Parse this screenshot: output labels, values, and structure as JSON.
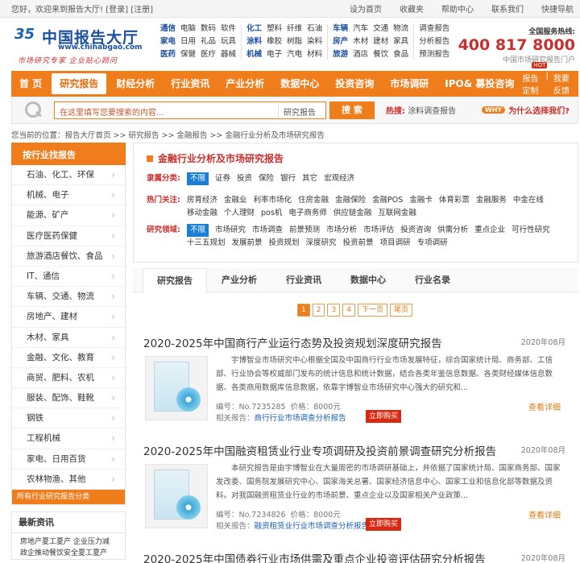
{
  "topbar": {
    "welcome": "您好，欢迎来到报告大厅!",
    "login": "[登录]",
    "register": "[注册]",
    "links": [
      "设为首页",
      "收藏夹",
      "帮助中心",
      "联系我们",
      "快捷导航"
    ]
  },
  "logo": {
    "name": "中国报告大厅",
    "url": "www.chinabgao.com",
    "slogan": "市场研究专家  企业贴心顾问"
  },
  "categories": [
    {
      "bold": "通信",
      "items": [
        "电脑",
        "数码",
        "软件"
      ]
    },
    {
      "bold": "家电",
      "items": [
        "日用",
        "礼品",
        "玩具"
      ]
    },
    {
      "bold": "医药",
      "items": [
        "保健",
        "医疗",
        "器械"
      ]
    },
    {
      "bold": "化工",
      "items": [
        "塑料",
        "纤维",
        "石油"
      ]
    },
    {
      "bold": "涂料",
      "items": [
        "橡胶",
        "树脂",
        "染料"
      ]
    },
    {
      "bold": "机械",
      "items": [
        "电子",
        "汽电",
        "材料"
      ]
    },
    {
      "bold": "车辆",
      "items": [
        "汽车",
        "交通",
        "物流"
      ]
    },
    {
      "bold": "房产",
      "items": [
        "木材",
        "建材",
        "家具"
      ]
    },
    {
      "bold": "旅游",
      "items": [
        "酒店",
        "餐饮",
        "食品"
      ]
    }
  ],
  "categories_extra": [
    "调查报告",
    "分析报告",
    "预测报告"
  ],
  "hotline": {
    "title": "全国服务热线:",
    "number": "400 817 8000",
    "sub": "中国市场研究报告门户"
  },
  "nav": {
    "items": [
      "首 页",
      "研究报告",
      "财经分析",
      "行业资讯",
      "产业分析",
      "数据中心",
      "投资咨询",
      "市场调研",
      "IPO& 募投咨询"
    ],
    "active_index": 1,
    "hot": "HOT",
    "right": [
      "报告定制",
      "我要反馈"
    ]
  },
  "search": {
    "placeholder": "在这里填写您要搜索的内容...",
    "select": "研究报告",
    "button": "搜 索",
    "hot_label": "热搜:",
    "hot_term": "涂料调查报告",
    "why_badge": "WHY",
    "why_text": "为什么选择我们?"
  },
  "breadcrumb": "您当前的位置：报告大厅首页 >> 研究报告 >> 金融报告 >> 金融行业分析及市场研究报告",
  "sidebar": {
    "title": "按行业找报告",
    "items": [
      "石油、化工、环保",
      "机械、电子",
      "能源、矿产",
      "医疗医药保健",
      "旅游酒店餐饮、食品",
      "IT、通信",
      "车辆、交通、物流",
      "房地产、建材",
      "木材、家具",
      "金融、文化、教育",
      "商贸、肥料、农机",
      "服装、配饰、鞋靴",
      "钢铁",
      "工程机械",
      "家电、日用百货",
      "农林物渔、其他"
    ],
    "footer": "所有行业研究报告分类",
    "news_title": "最新资讯",
    "news": [
      "房地产夏工夏产 企业压力减",
      "政企推动餐饮安全夏工夏产"
    ]
  },
  "filter": {
    "title": "金融行业分析及市场研究报告",
    "rows": [
      {
        "label": "隶属分类:",
        "selected": "不限",
        "items": [
          "证券",
          "投资",
          "保险",
          "银行",
          "其它",
          "宏观经济"
        ]
      },
      {
        "label": "热门关注:",
        "selected": "",
        "items": [
          "房育经济",
          "金融业",
          "利率市场化",
          "住房金融",
          "金融保险",
          "金融POS",
          "金融卡",
          "体育彩票",
          "金融服务",
          "中金在线",
          "移动金融",
          "个人理财",
          "pos机",
          "电子商务师",
          "供应链金融",
          "互联网金融"
        ]
      },
      {
        "label": "研究领域:",
        "selected": "不限",
        "items": [
          "市场研究",
          "市场调查",
          "前景预测",
          "市场分析",
          "市场评估",
          "投资咨询",
          "供需分析",
          "重点企业",
          "可行性研究",
          "十三五规划",
          "发展前景",
          "投资规划",
          "深度研究",
          "投资前景",
          "项目调研",
          "专项调研"
        ]
      }
    ]
  },
  "tabs": [
    "研究报告",
    "产业分析",
    "行业资讯",
    "数据中心",
    "行业名录"
  ],
  "pager": [
    "1",
    "2",
    "3",
    "4",
    "下一页",
    "尾页"
  ],
  "reports": [
    {
      "title": "2020-2025年中国商行产业运行态势及投资规划深度研究报告",
      "date": "2020年08月",
      "desc": "宇博智业市场研究中心根据全国及中国商行行业市场发展特征，综合国家统计局、商务部、工信部、行业协会等权威部门发布的统计信息和统计数据，结合各类年鉴信息数据、各类财经媒体信息数据、各类商用数据库信息数据，依靠宇博智业市场研究中心强大的研究和...",
      "code": "编号：No.7235285",
      "price": "价格：8000元",
      "rel_label": "相关报告：",
      "rel": "商行行业市场调查分析报告",
      "buy": "立即购买",
      "more": "查看详细"
    },
    {
      "title": "2020-2025年中国融资租赁业行业专项调研及投资前景调查研究分析报告",
      "date": "2020年08月",
      "desc": "本研究报告是由宇博智业在大量周密的市场调研基础上，并依据了国家统计局、国家商务部、国家发改委、国务院发展研究中心、国家海关总署、国家经济信息中心、国家工业和信息化部等数据及资料。对我国融资租赁业行业的市场前景、重点企业以及国家相关产业政策...",
      "code": "编号：No.7234826",
      "price": "价格：8000元",
      "rel_label": "相关报告：",
      "rel": "融资租赁业行业市场调查分析报告",
      "buy": "立即购买",
      "more": "查看详细"
    },
    {
      "title": "2020-2025年中国债券行业市场供需及重点企业投资评估研究分析报告",
      "date": "2020年08月"
    }
  ]
}
